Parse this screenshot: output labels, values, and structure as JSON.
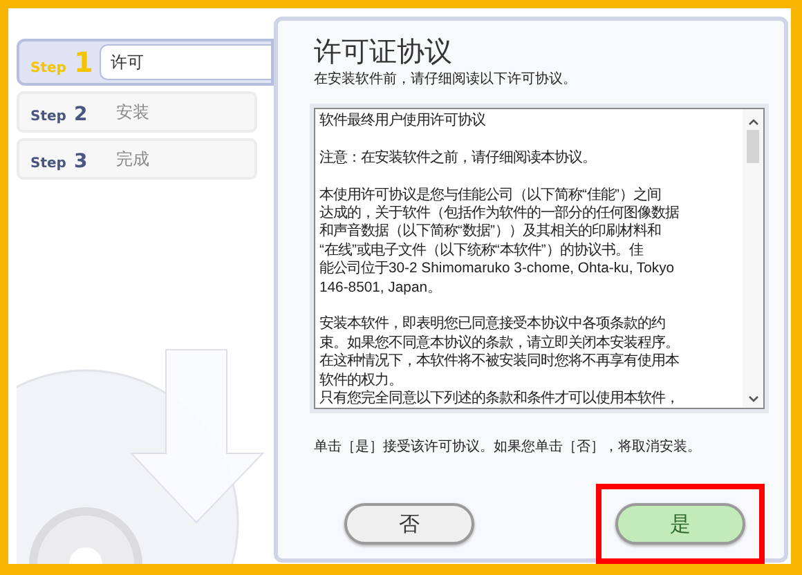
{
  "steps": [
    {
      "prefix": "Step",
      "number": "1",
      "name": "许可",
      "selected": true
    },
    {
      "prefix": "Step",
      "number": "2",
      "name": "安装",
      "selected": false
    },
    {
      "prefix": "Step",
      "number": "3",
      "name": "完成",
      "selected": false
    }
  ],
  "panel": {
    "title": "许可证协议",
    "subtitle": "在安装软件前，请仔细阅读以下许可协议。",
    "license_text": [
      [
        "软件最终用户使用许可协议"
      ],
      [
        "注意：在安装软件之前，请仔细阅读本协议。"
      ],
      [
        "本使用许可协议是您与佳能公司（以下简称“佳能”）之间",
        "达成的，关于软件（包括作为软件的一部分的任何图像数据",
        "和声音数据（以下简称“数据”））及其相关的印刷材料和",
        "“在线”或电子文件（以下统称“本软件”）的协议书。佳",
        "能公司位于30-2 Shimomaruko 3-chome, Ohta-ku, Tokyo",
        "146-8501, Japan。"
      ],
      [
        "安装本软件，即表明您已同意接受本协议中各项条款的约",
        "束。如果您不同意本协议的条款，请立即关闭本安装程序。",
        "在这种情况下，本软件将不被安装同时您将不再享有使用本",
        "软件的权力。",
        "只有您完全同意以下列述的条款和条件才可以使用本软件，"
      ]
    ],
    "instruction": "单击［是］接受该许可协议。如果您单击［否］，将取消安装。",
    "buttons": [
      {
        "label": "否",
        "kind": "no",
        "highlighted": false
      },
      {
        "label": "是",
        "kind": "yes",
        "highlighted": true
      }
    ]
  }
}
